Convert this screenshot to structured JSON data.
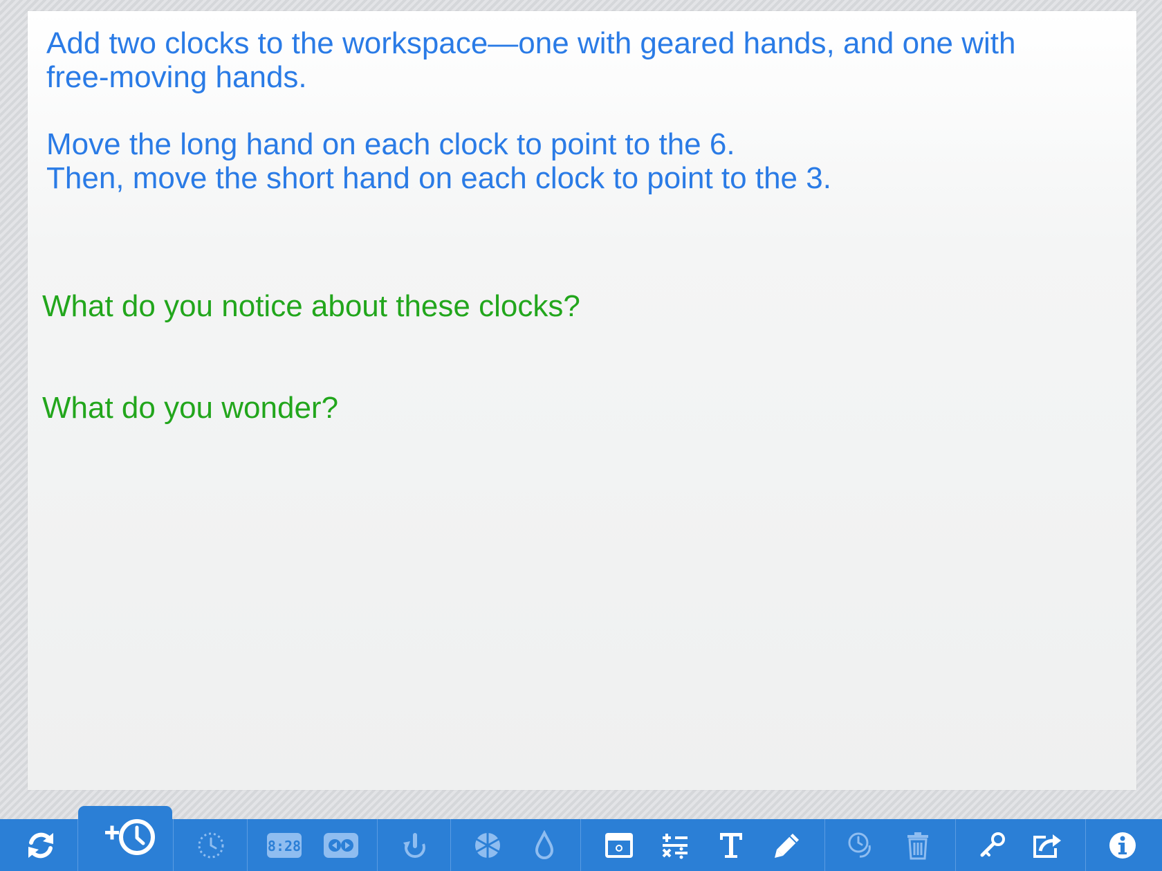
{
  "workspace": {
    "instruction_1": "Add two clocks to the workspace—one with geared hands, and one with\nfree-moving hands.",
    "instruction_2": "Move the long hand on each clock to point to the 6.\nThen, move the short hand on each clock to point to the 3.",
    "question_1": "What do you notice about these clocks?",
    "question_2": "What do you wonder?"
  },
  "colors": {
    "instruction_text": "#2a7be6",
    "question_text": "#22a61c",
    "toolbar_bg": "#2b7fd6",
    "icon_active": "#ffffff",
    "icon_inactive": "#8fbdf0"
  },
  "toolbar": {
    "buttons": [
      {
        "icon": "reset-icon",
        "state": "active"
      },
      {
        "icon": "add-clock-icon",
        "state": "active"
      },
      {
        "icon": "dotted-clock-icon",
        "state": "disabled"
      },
      {
        "icon": "digital-display-icon",
        "state": "disabled"
      },
      {
        "icon": "tape-icon",
        "state": "disabled"
      },
      {
        "icon": "rotate-hand-icon",
        "state": "disabled"
      },
      {
        "icon": "pie-fraction-icon",
        "state": "disabled"
      },
      {
        "icon": "color-drop-icon",
        "state": "disabled"
      },
      {
        "icon": "cover-window-icon",
        "state": "active"
      },
      {
        "icon": "math-operations-icon",
        "state": "active"
      },
      {
        "icon": "text-icon",
        "state": "active"
      },
      {
        "icon": "pencil-icon",
        "state": "active"
      },
      {
        "icon": "duplicate-clock-icon",
        "state": "disabled"
      },
      {
        "icon": "trash-icon",
        "state": "disabled"
      },
      {
        "icon": "key-icon",
        "state": "active"
      },
      {
        "icon": "share-icon",
        "state": "active"
      },
      {
        "icon": "info-icon",
        "state": "active"
      }
    ]
  }
}
